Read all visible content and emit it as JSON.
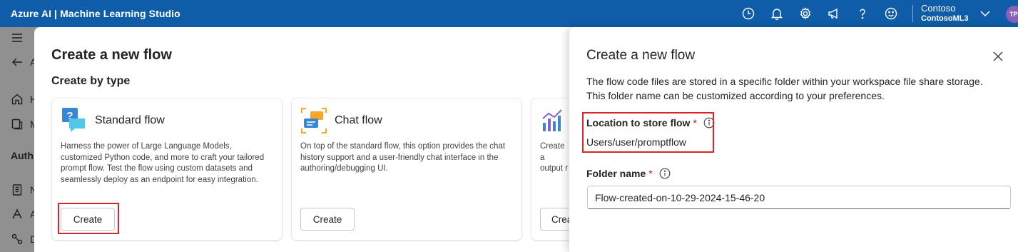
{
  "topbar": {
    "title": "Azure AI | Machine Learning Studio",
    "icons": [
      "clock-icon",
      "bell-icon",
      "gear-icon",
      "megaphone-icon",
      "help-icon",
      "smiley-icon"
    ],
    "account": {
      "directory": "Contoso",
      "workspace": "ContosoML3",
      "avatar_initials": "TP"
    }
  },
  "leftnav": {
    "items": [
      {
        "icon": "hamburger-icon",
        "label": ""
      },
      {
        "icon": "back-arrow-icon",
        "label": "A"
      },
      {
        "icon": "home-icon",
        "label": "H"
      },
      {
        "icon": "catalog-icon",
        "label": "M"
      },
      {
        "icon": "",
        "label": "Auth"
      },
      {
        "icon": "notebook-icon",
        "label": "N"
      },
      {
        "icon": "automl-icon",
        "label": "A"
      },
      {
        "icon": "designer-icon",
        "label": "D"
      }
    ]
  },
  "dialog": {
    "title": "Create a new flow",
    "section": "Create by type",
    "cards": [
      {
        "title": "Standard flow",
        "description": "Harness the power of Large Language Models, customized Python code, and more to craft your tailored prompt flow. Test the flow using custom datasets and seamlessly deploy as an endpoint for easy integration.",
        "button": "Create"
      },
      {
        "title": "Chat flow",
        "description": "On top of the standard flow, this option provides the chat history support and a user-friendly chat interface in the authoring/debugging UI.",
        "button": "Create"
      },
      {
        "title": "",
        "description": "Create a output r",
        "button": "Crea"
      }
    ]
  },
  "panel": {
    "title": "Create a new flow",
    "description": "The flow code files are stored in a specific folder within your workspace file share storage. This folder name can be customized according to your preferences.",
    "location_label": "Location to store flow",
    "location_value": "Users/user/promptflow",
    "folder_label": "Folder name",
    "folder_value": "Flow-created-on-10-29-2024-15-46-20",
    "required_marker": "*"
  },
  "colors": {
    "topbar": "#0f5ca8",
    "highlight": "#d9252c",
    "required": "#c50f1f"
  }
}
